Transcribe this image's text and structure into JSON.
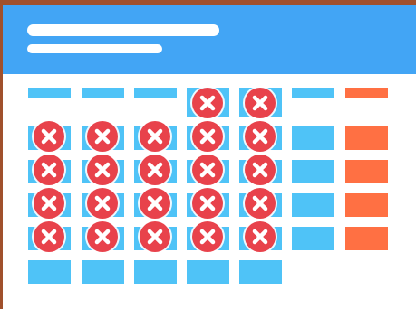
{
  "colors": {
    "edge": "#a0502c",
    "header": "#42a5f5",
    "available": "#4fc3f7",
    "highlight": "#ff7043",
    "blocked_mark": "#e8424b"
  },
  "header": {
    "title_placeholder": "",
    "subtitle_placeholder": ""
  },
  "grid": {
    "columns": [
      {
        "kind": "regular",
        "rows": 5,
        "blocked": 4
      },
      {
        "kind": "regular",
        "rows": 5,
        "blocked": 4
      },
      {
        "kind": "regular",
        "rows": 5,
        "blocked": 4
      },
      {
        "kind": "regular",
        "rows": 6,
        "blocked": 5
      },
      {
        "kind": "regular",
        "rows": 6,
        "blocked": 5
      },
      {
        "kind": "regular",
        "rows": 4,
        "blocked": 0
      },
      {
        "kind": "highlight",
        "rows": 4,
        "blocked": 0
      }
    ],
    "blocked_icon": "close-icon"
  }
}
